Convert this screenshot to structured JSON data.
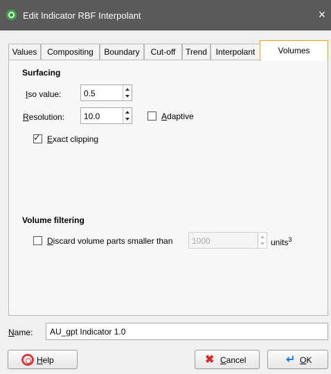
{
  "window": {
    "title": "Edit Indicator RBF Interpolant",
    "close_icon": "×"
  },
  "tabs": [
    {
      "label": "Values"
    },
    {
      "label": "Compositing"
    },
    {
      "label": "Boundary"
    },
    {
      "label": "Cut-off"
    },
    {
      "label": "Trend"
    },
    {
      "label": "Interpolant"
    },
    {
      "label": "Volumes",
      "active": true
    }
  ],
  "surfacing": {
    "heading": "Surfacing",
    "iso_value": {
      "label_key": "I",
      "label_rest": "so value:",
      "value": "0.5"
    },
    "resolution": {
      "label_key": "R",
      "label_rest": "esolution:",
      "value": "10.0"
    },
    "adaptive": {
      "label_key": "A",
      "label_rest": "daptive",
      "checked": false
    },
    "exact_clipping": {
      "label_key": "E",
      "label_rest": "xact clipping",
      "checked": true
    }
  },
  "volume_filtering": {
    "heading": "Volume filtering",
    "discard": {
      "label_key": "D",
      "label_rest": "iscard volume parts smaller than",
      "checked": false,
      "value": "1000",
      "units": "units",
      "units_sup": "3"
    }
  },
  "name": {
    "label_key": "N",
    "label_rest": "ame:",
    "value": "AU_gpt Indicator 1.0"
  },
  "buttons": {
    "help": {
      "label_key": "H",
      "label_rest": "elp",
      "icon": "lifebuoy-icon"
    },
    "cancel": {
      "label_key": "C",
      "label_rest": "ancel",
      "icon": "red-x-icon"
    },
    "ok": {
      "label_key": "O",
      "label_rest": "K",
      "icon": "enter-arrow-icon"
    }
  },
  "colors": {
    "title_bar": "#5a5a5a",
    "active_tab_border": "#f0a000",
    "app_icon": "#3aa84a"
  }
}
